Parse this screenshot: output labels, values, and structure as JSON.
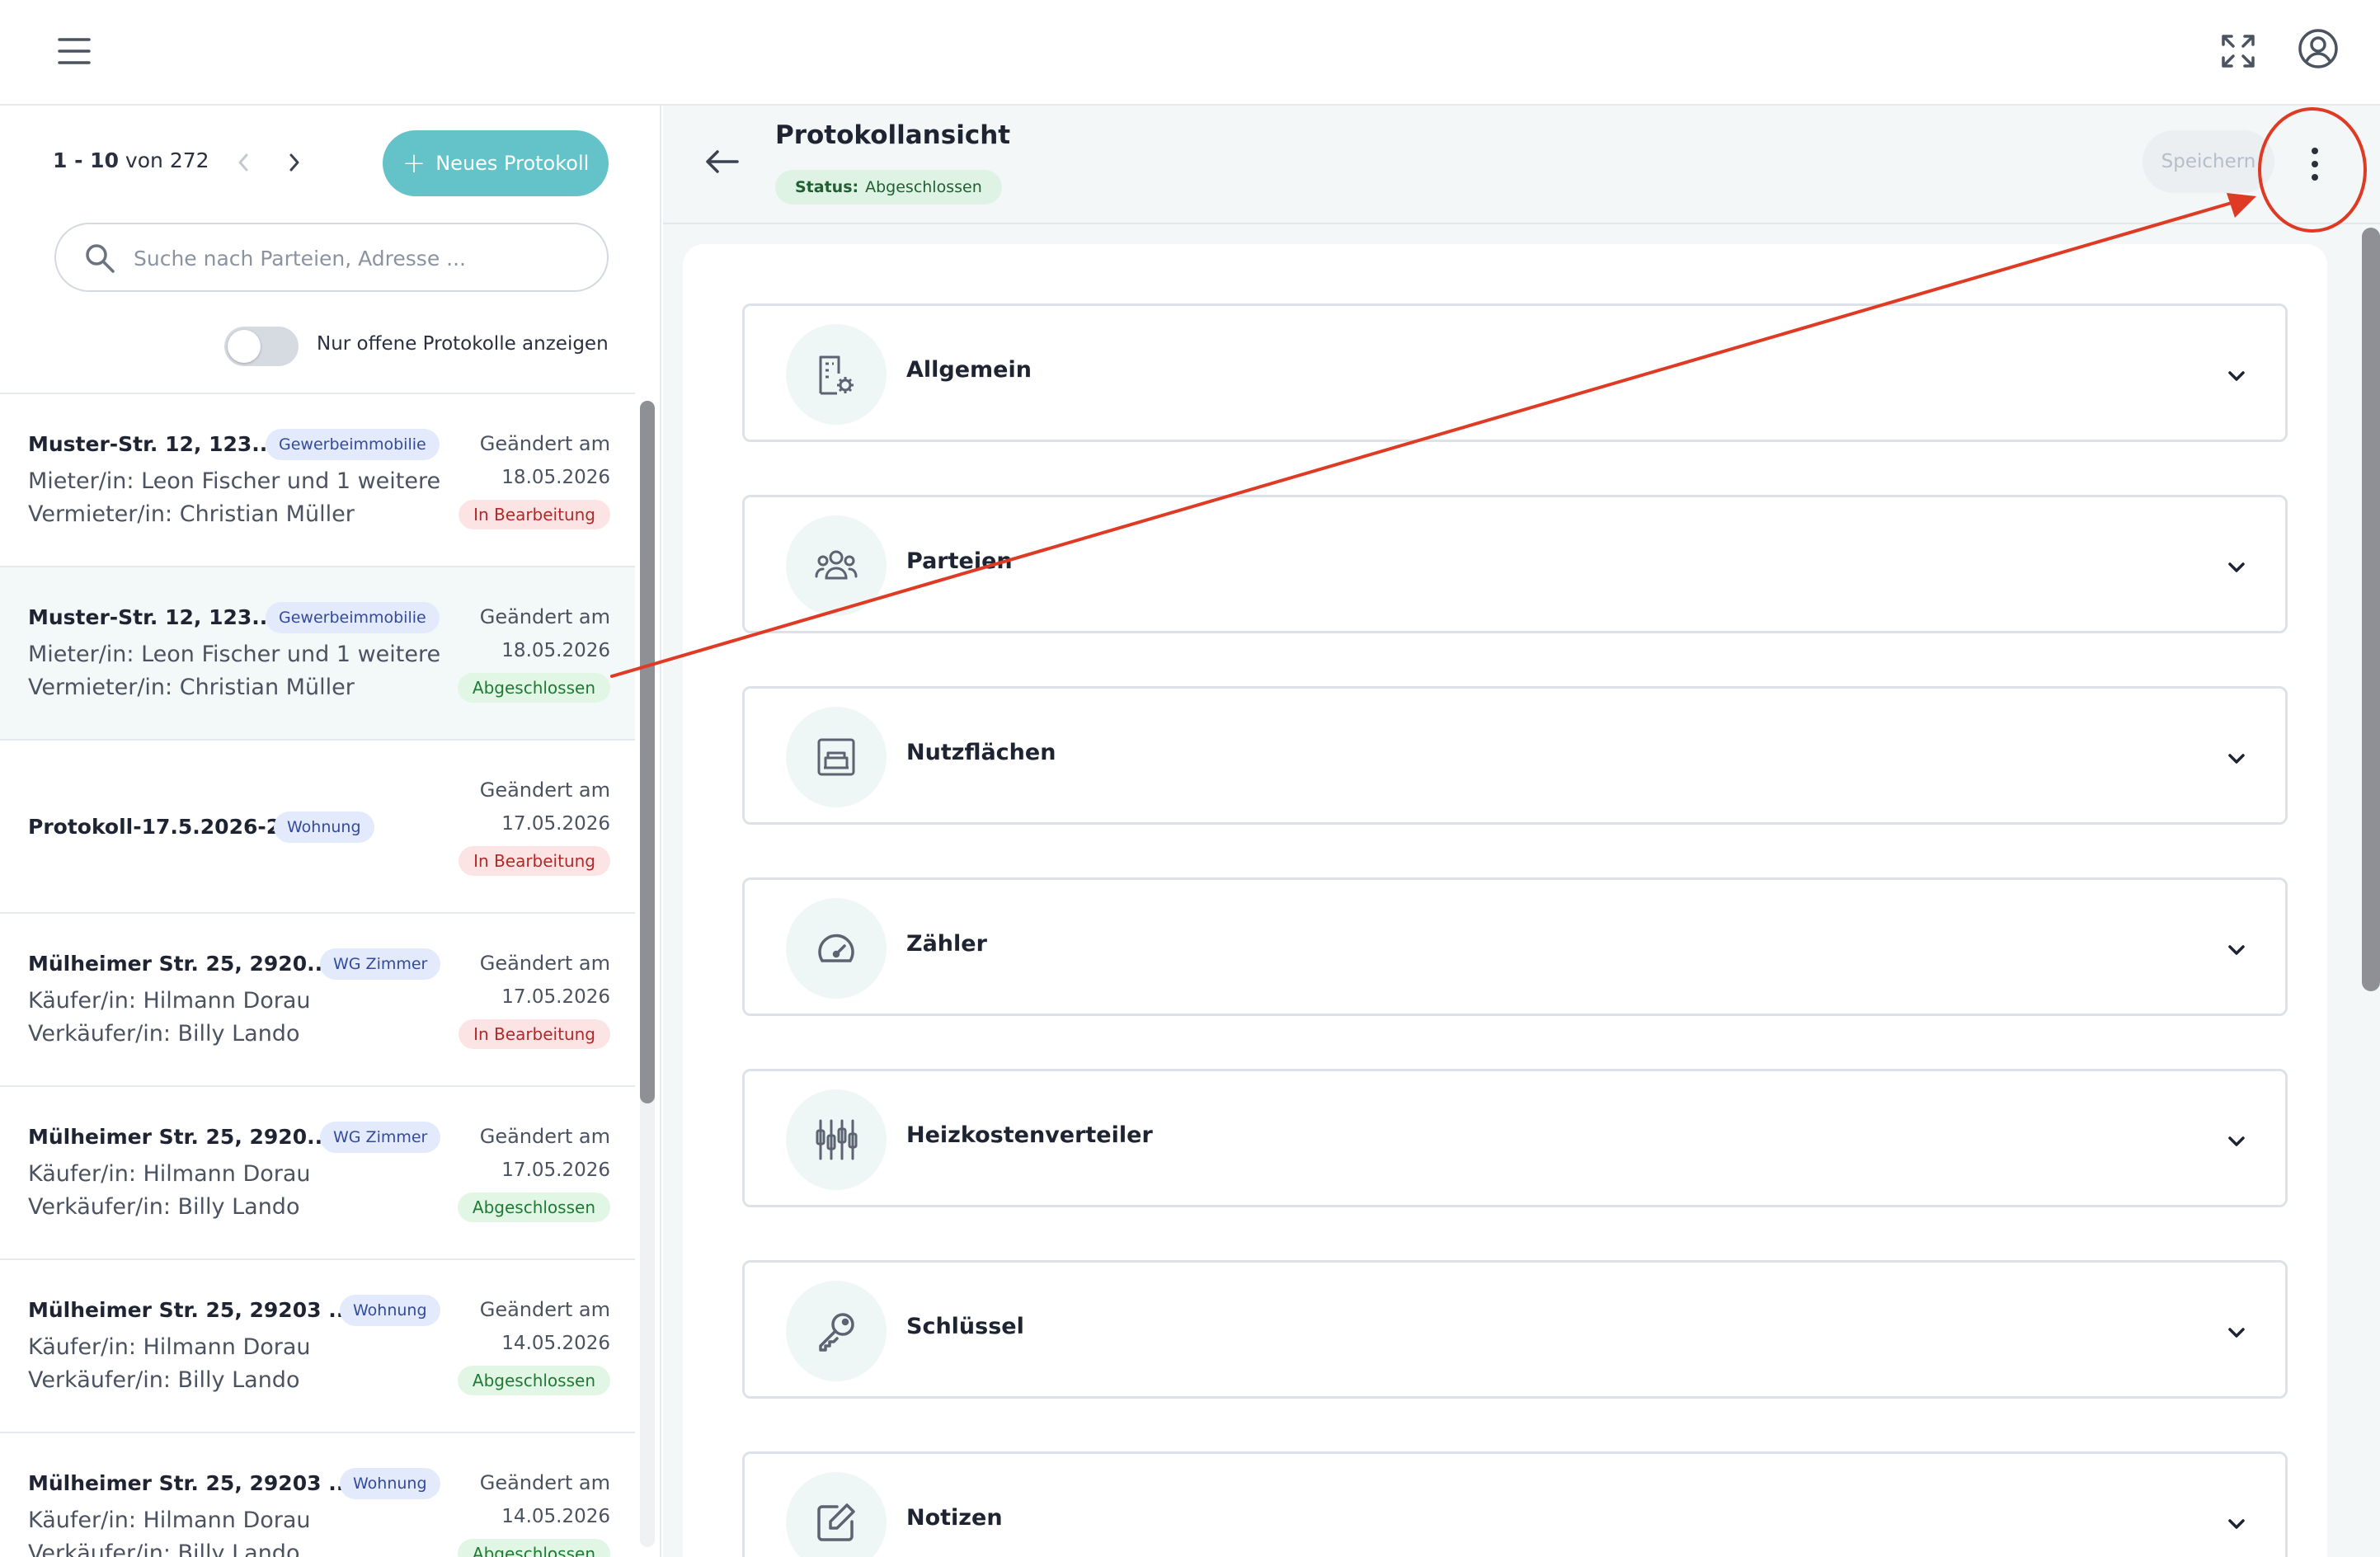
{
  "pager": {
    "range": "1 - 10",
    "von": "von",
    "total": "272"
  },
  "new_button_label": "Neues Protokoll",
  "search_placeholder": "Suche nach Parteien, Adresse ...",
  "toggle_label": "Nur offene Protokolle anzeigen",
  "list_items": [
    {
      "title": "Muster-Str. 12, 123...",
      "tag": "Gewerbeimmobilie",
      "line1": "Mieter/in: Leon Fischer und 1 weitere",
      "line2": "Vermieter/in: Christian Müller",
      "changed": "Geändert am",
      "date": "18.05.2026",
      "status": "In Bearbeitung"
    },
    {
      "title": "Muster-Str. 12, 123...",
      "tag": "Gewerbeimmobilie",
      "line1": "Mieter/in: Leon Fischer und 1 weitere",
      "line2": "Vermieter/in: Christian Müller",
      "changed": "Geändert am",
      "date": "18.05.2026",
      "status": "Abgeschlossen"
    },
    {
      "title": "Protokoll-17.5.2026-2",
      "tag": "Wohnung",
      "line1": "",
      "line2": "",
      "changed": "Geändert am",
      "date": "17.05.2026",
      "status": "In Bearbeitung"
    },
    {
      "title": "Mülheimer Str. 25, 2920...",
      "tag": "WG Zimmer",
      "line1": "Käufer/in: Hilmann Dorau",
      "line2": "Verkäufer/in: Billy Lando",
      "changed": "Geändert am",
      "date": "17.05.2026",
      "status": "In Bearbeitung"
    },
    {
      "title": "Mülheimer Str. 25, 2920...",
      "tag": "WG Zimmer",
      "line1": "Käufer/in: Hilmann Dorau",
      "line2": "Verkäufer/in: Billy Lando",
      "changed": "Geändert am",
      "date": "17.05.2026",
      "status": "Abgeschlossen"
    },
    {
      "title": "Mülheimer Str. 25, 29203 ...",
      "tag": "Wohnung",
      "line1": "Käufer/in: Hilmann Dorau",
      "line2": "Verkäufer/in: Billy Lando",
      "changed": "Geändert am",
      "date": "14.05.2026",
      "status": "Abgeschlossen"
    },
    {
      "title": "Mülheimer Str. 25, 29203 ...",
      "tag": "Wohnung",
      "line1": "Käufer/in: Hilmann Dorau",
      "line2": "Verkäufer/in: Billy Lando",
      "changed": "Geändert am",
      "date": "14.05.2026",
      "status": "Abgeschlossen"
    }
  ],
  "header": {
    "title": "Protokollansicht",
    "status_key": "Status:",
    "status_value": "Abgeschlossen",
    "save_label": "Speichern"
  },
  "sections": [
    {
      "label": "Allgemein",
      "icon": "building-settings-icon"
    },
    {
      "label": "Parteien",
      "icon": "people-icon"
    },
    {
      "label": "Nutzflächen",
      "icon": "room-icon"
    },
    {
      "label": "Zähler",
      "icon": "gauge-icon"
    },
    {
      "label": "Heizkostenverteiler",
      "icon": "heating-icon"
    },
    {
      "label": "Schlüssel",
      "icon": "key-icon"
    },
    {
      "label": "Notizen",
      "icon": "edit-note-icon"
    }
  ],
  "colors": {
    "accent": "#64c3c9",
    "annotation": "#de3a24",
    "status_red_bg": "#fde4e4",
    "status_green_bg": "#e2f6e5"
  }
}
